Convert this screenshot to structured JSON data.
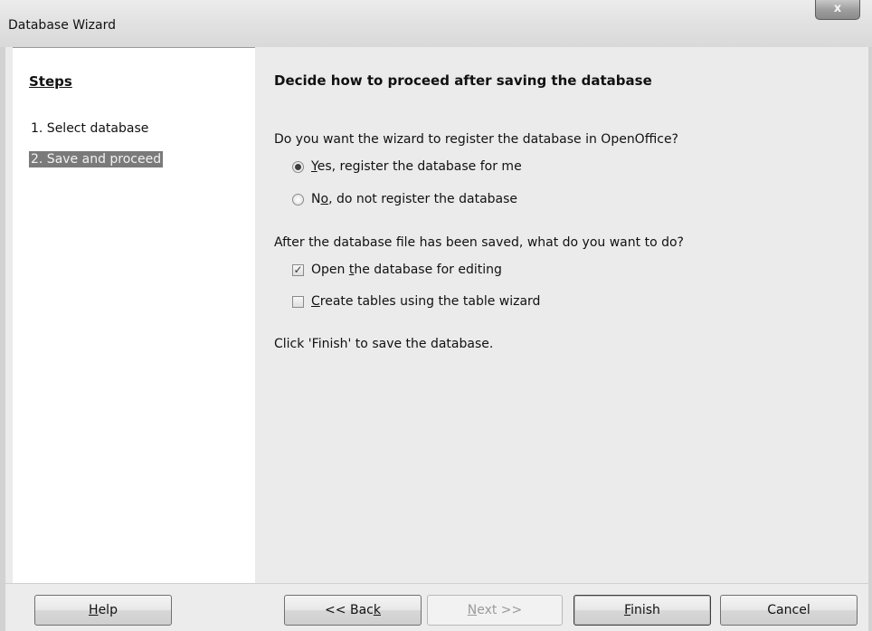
{
  "window": {
    "title": "Database Wizard",
    "close_glyph": "x"
  },
  "steps": {
    "heading": "Steps",
    "items": [
      {
        "label": "1. Select database",
        "active": false
      },
      {
        "label": "2. Save and proceed",
        "active": true
      }
    ]
  },
  "main": {
    "heading": "Decide how to proceed after saving the database",
    "register_question": "Do you want the wizard to register the database in OpenOffice?",
    "register_options": [
      {
        "mnemonic": "Y",
        "rest": "es, register the database for me",
        "checked": true
      },
      {
        "prefix": "N",
        "mnemonic": "o",
        "rest": ", do not register the database",
        "checked": false
      }
    ],
    "after_question": "After the database file has been saved, what do you want to do?",
    "after_options": [
      {
        "prefix": "Open ",
        "mnemonic": "t",
        "rest": "he database for editing",
        "checked": true,
        "check_glyph": "✓"
      },
      {
        "mnemonic": "C",
        "rest": "reate tables using the table wizard",
        "checked": false
      }
    ],
    "finish_note": "Click 'Finish' to save the database."
  },
  "buttons": {
    "help": {
      "mnemonic": "H",
      "rest": "elp"
    },
    "back": {
      "prefix": "<< Bac",
      "mnemonic": "k"
    },
    "next": {
      "mnemonic": "N",
      "rest": "ext >>",
      "enabled": false
    },
    "finish": {
      "mnemonic": "F",
      "rest": "inish"
    },
    "cancel": "Cancel"
  }
}
